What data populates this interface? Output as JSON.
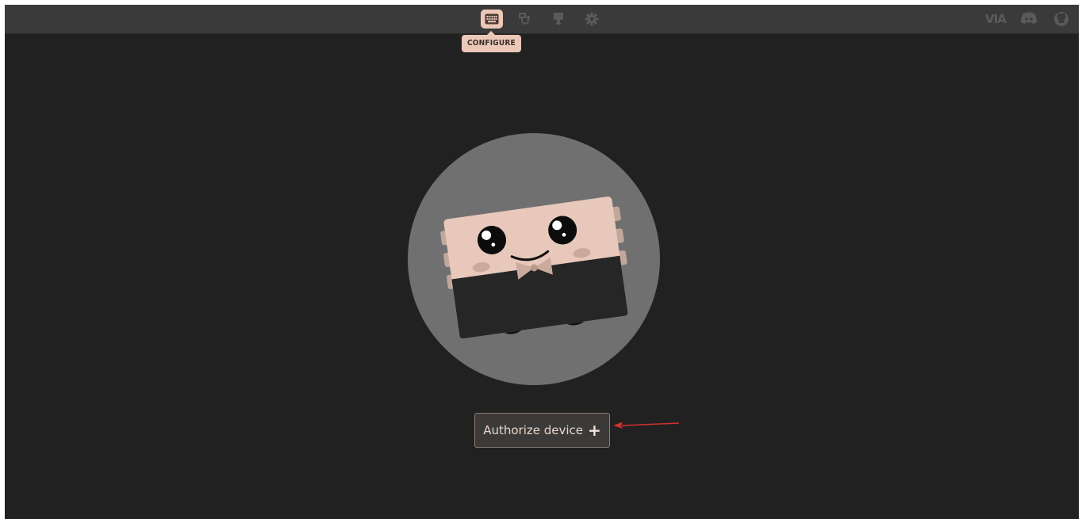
{
  "topbar": {
    "nav": [
      {
        "name": "configure",
        "icon": "keyboard-icon",
        "active": true
      },
      {
        "name": "test",
        "icon": "test-icon",
        "active": false
      },
      {
        "name": "design",
        "icon": "design-icon",
        "active": false
      },
      {
        "name": "settings",
        "icon": "gear-icon",
        "active": false
      }
    ],
    "tooltip": "CONFIGURE",
    "right": {
      "logo": "VIA",
      "icons": [
        "discord-icon",
        "github-icon"
      ]
    }
  },
  "main": {
    "illustration": "keyboard-mascot-illustration",
    "authorize_label": "Authorize device",
    "authorize_icon": "+",
    "annotation": "red-arrow"
  },
  "colors": {
    "background": "#212121",
    "topbar": "#3a3a3a",
    "accent": "#ebc8b8",
    "annotation": "#d0312d"
  }
}
